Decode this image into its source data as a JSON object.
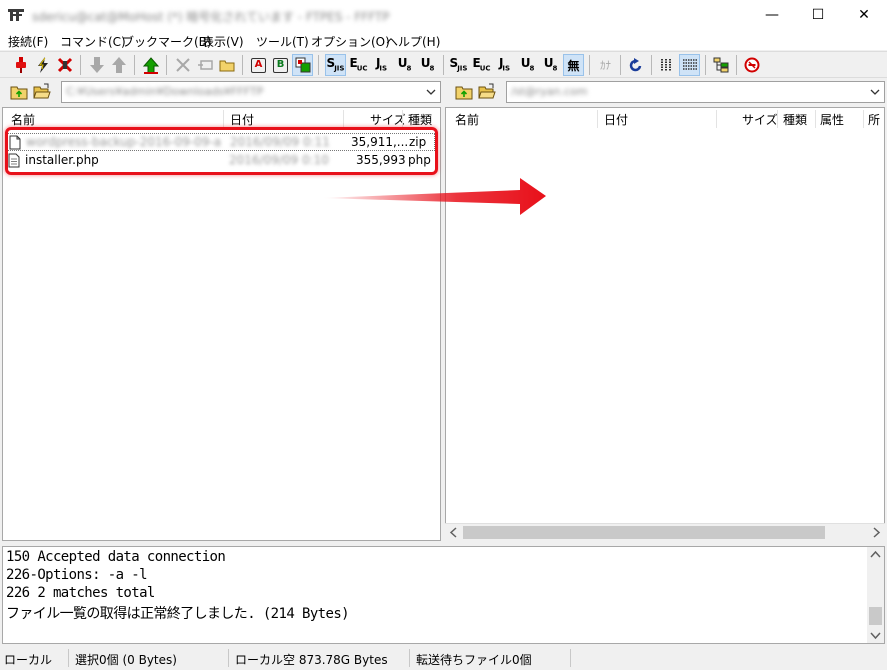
{
  "window": {
    "title": "sdericu@cat@MoHost (*) 暗号化されています - FTPES - FFFTP",
    "minimize_glyph": "—",
    "maximize_glyph": "☐",
    "close_glyph": "✕"
  },
  "menu": [
    "接続(F)",
    "コマンド(C)",
    "ブックマーク(B)",
    "表示(V)",
    "ツール(T)",
    "オプション(O)",
    "ヘルプ(H)"
  ],
  "toolbar": {
    "kanji_label": "無",
    "kana_label": "ｶﾅ",
    "ascii_label": "A",
    "binary_label": "B",
    "sjis": "S",
    "euc": "E",
    "jis": "J",
    "utf8n": "U",
    "utf8bom": "U"
  },
  "local": {
    "path": "C:¥Users¥admin¥Downloads¥FFFTP",
    "columns": [
      "名前",
      "日付",
      "サイズ",
      "種類"
    ],
    "files": [
      {
        "name": "wordpress-backup-2016-09-09-archive.zip",
        "date": "2016/09/09 0:11",
        "size": "35,911,...",
        "type": "zip"
      },
      {
        "name": "installer.php",
        "date": "2016/09/09 0:10",
        "size": "355,993",
        "type": "php"
      }
    ]
  },
  "remote": {
    "path": "/st@ryan.com",
    "columns": [
      "名前",
      "日付",
      "サイズ",
      "種類",
      "属性",
      "所"
    ]
  },
  "log": [
    "150 Accepted data connection",
    "226-Options: -a -l",
    "226 2 matches total",
    "ファイル一覧の取得は正常終了しました. (214 Bytes)"
  ],
  "status": {
    "mode": "ローカル",
    "selection": "選択0個 (0 Bytes)",
    "free": "ローカル空 873.78G Bytes",
    "queue": "転送待ちファイル0個"
  },
  "colors": {
    "highlight_border": "#e8101a",
    "arrow": "#e8101a",
    "accent": "#0a7a1d"
  }
}
